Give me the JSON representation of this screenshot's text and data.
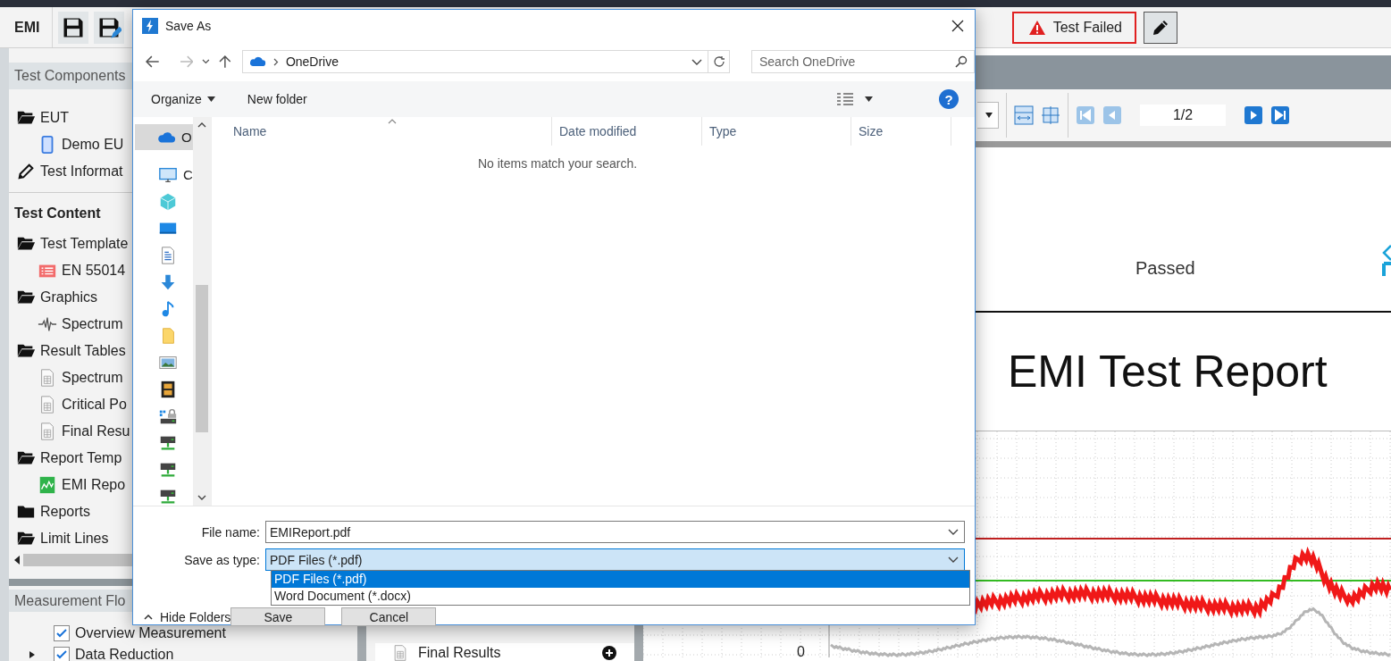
{
  "app": {
    "title": "EMI",
    "status_label": "Test Failed"
  },
  "components": {
    "header": "Test Components",
    "items": [
      {
        "label": "EUT",
        "kind": "folder_open",
        "children": [
          {
            "label": "Demo EU",
            "kind": "device"
          }
        ]
      },
      {
        "label": "Test Informat",
        "kind": "pencil"
      }
    ]
  },
  "content": {
    "header": "Test Content",
    "items": [
      {
        "label": "Test Template",
        "kind": "folder_open",
        "children": [
          {
            "label": "EN 55014",
            "kind": "template"
          }
        ]
      },
      {
        "label": "Graphics",
        "kind": "folder_open",
        "children": [
          {
            "label": "Spectrum",
            "kind": "wave"
          }
        ]
      },
      {
        "label": "Result Tables",
        "kind": "folder_open",
        "children": [
          {
            "label": "Spectrum",
            "kind": "table"
          },
          {
            "label": "Critical Po",
            "kind": "table"
          },
          {
            "label": "Final Resu",
            "kind": "table"
          }
        ]
      },
      {
        "label": "Report Temp",
        "kind": "folder_open",
        "children": [
          {
            "label": "EMI Repo",
            "kind": "report"
          }
        ]
      },
      {
        "label": "Reports",
        "kind": "folder_closed"
      },
      {
        "label": "Limit Lines",
        "kind": "folder_open"
      }
    ]
  },
  "flow": {
    "header": "Measurement Flo",
    "steps": [
      {
        "label": "Overview Measurement",
        "checked": true,
        "kind": "leaf"
      },
      {
        "label": "Data Reduction",
        "checked": true,
        "kind": "group"
      }
    ]
  },
  "steps_panel": {
    "items": [
      {
        "label": "Final Results"
      }
    ]
  },
  "report": {
    "page": "1/2",
    "verdict": "Passed",
    "title": "EMI Test Report",
    "axis_label": "0"
  },
  "dialog": {
    "title": "Save As",
    "address": "OneDrive",
    "search_placeholder": "Search OneDrive",
    "commands": [
      {
        "label": "Organize",
        "menu": true
      },
      {
        "label": "New folder",
        "menu": false
      }
    ],
    "help_label": "?",
    "nav_items": [
      {
        "kind": "cloud",
        "label": "O",
        "selected": true
      },
      {
        "kind": "pc",
        "label": "C",
        "selected": false
      },
      {
        "kind": "cube",
        "selected": false
      },
      {
        "kind": "desktop",
        "selected": false
      },
      {
        "kind": "document",
        "selected": false
      },
      {
        "kind": "download",
        "selected": false
      },
      {
        "kind": "music",
        "selected": false
      },
      {
        "kind": "folder",
        "selected": false
      },
      {
        "kind": "pictures",
        "selected": false
      },
      {
        "kind": "videos",
        "selected": false
      },
      {
        "kind": "drive_lock",
        "selected": false
      },
      {
        "kind": "network",
        "selected": false
      },
      {
        "kind": "network",
        "selected": false
      },
      {
        "kind": "network",
        "selected": false
      }
    ],
    "columns": [
      "Name",
      "Date modified",
      "Type",
      "Size"
    ],
    "empty_message": "No items match your search.",
    "file_name": {
      "label": "File name:",
      "value": "EMIReport.pdf"
    },
    "save_type": {
      "label": "Save as type:",
      "value": "PDF Files (*.pdf)",
      "expanded": true,
      "options": [
        {
          "label": "PDF Files (*.pdf)",
          "selected": true
        },
        {
          "label": "Word Document (*.docx)",
          "selected": false
        }
      ]
    },
    "hide_folders": "Hide Folders",
    "buttons": [
      "Save",
      "Cancel"
    ]
  }
}
